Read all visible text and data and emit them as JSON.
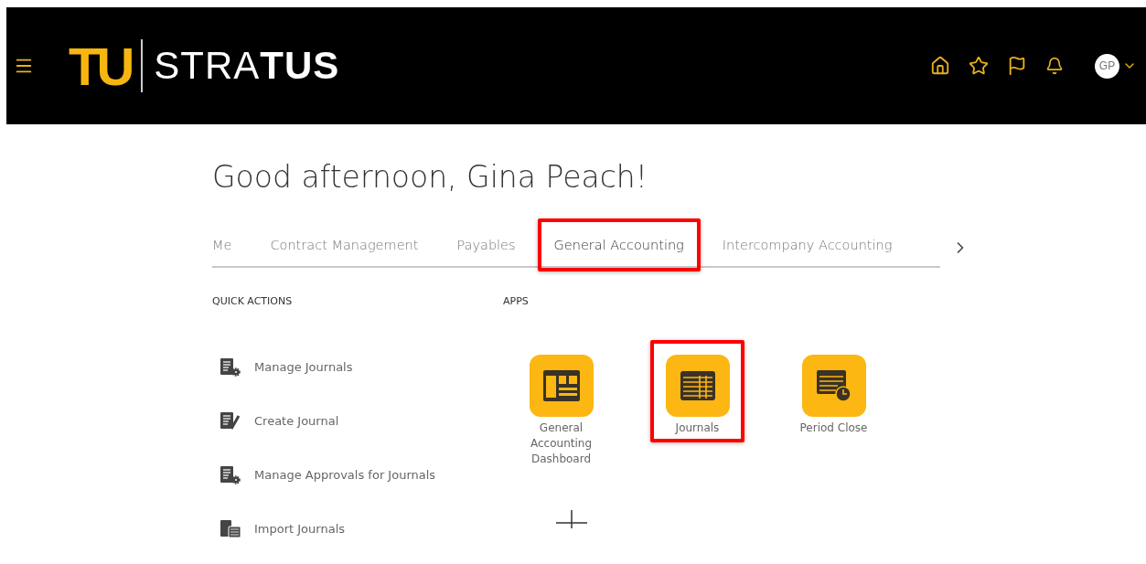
{
  "header": {
    "logo_mark": "TU",
    "logo_text": "STRA**TUS**",
    "avatar": "GP"
  },
  "greeting": "Good afternoon, Gina Peach!",
  "tabs": [
    {
      "label": "Me",
      "selected": false,
      "highlighted": false
    },
    {
      "label": "Contract Management",
      "selected": false,
      "highlighted": false
    },
    {
      "label": "Payables",
      "selected": false,
      "highlighted": false
    },
    {
      "label": "General Accounting",
      "selected": true,
      "highlighted": true
    },
    {
      "label": "Intercompany Accounting",
      "selected": false,
      "highlighted": false
    }
  ],
  "quick_actions": {
    "title": "QUICK ACTIONS",
    "items": [
      {
        "label": "Manage Journals",
        "kind": "manage"
      },
      {
        "label": "Create Journal",
        "kind": "create"
      },
      {
        "label": "Manage Approvals for Journals",
        "kind": "manage"
      },
      {
        "label": "Import Journals",
        "kind": "import"
      }
    ]
  },
  "apps": {
    "title": "APPS",
    "items": [
      {
        "label": "General Accounting Dashboard",
        "kind": "dashboard",
        "highlighted": false
      },
      {
        "label": "Journals",
        "kind": "table",
        "highlighted": true
      },
      {
        "label": "Period Close",
        "kind": "clock",
        "highlighted": false
      }
    ]
  }
}
